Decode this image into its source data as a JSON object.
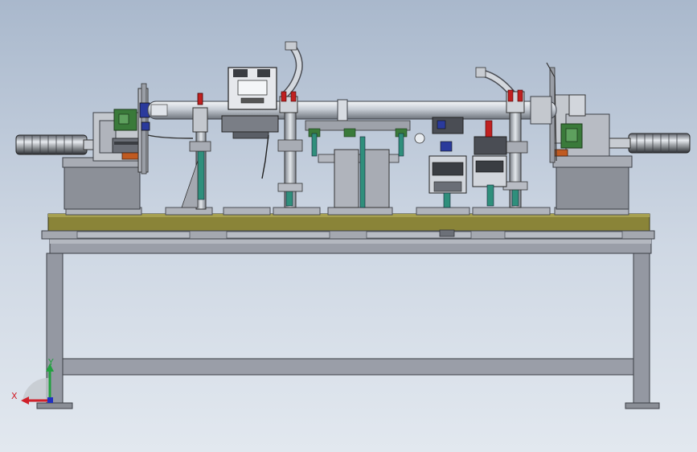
{
  "triad": {
    "x_label": "X",
    "y_label": "Y",
    "x_color": "#d0202a",
    "y_color": "#22a040",
    "z_color": "#2030c0"
  },
  "colors": {
    "background_top": "#a9b8cc",
    "background_bottom": "#e2e8ef",
    "frame": "#8c909a",
    "tabletop": "#8a8438",
    "teal_rods": "#2f8f7c",
    "green_blocks": "#3a7a3a",
    "red_accents": "#c02020",
    "blue_accents": "#2a3a9c"
  }
}
